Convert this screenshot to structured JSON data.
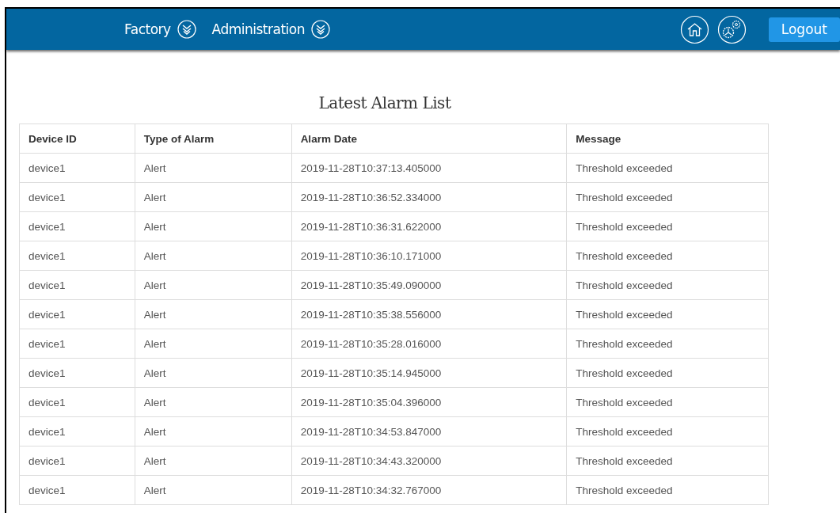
{
  "nav": {
    "menus": [
      {
        "label": "Factory"
      },
      {
        "label": "Administration"
      }
    ],
    "logout": "Logout"
  },
  "title": "Latest Alarm List",
  "table": {
    "columns": [
      "Device ID",
      "Type of Alarm",
      "Alarm Date",
      "Message"
    ],
    "rows": [
      [
        "device1",
        "Alert",
        "2019-11-28T10:37:13.405000",
        "Threshold exceeded"
      ],
      [
        "device1",
        "Alert",
        "2019-11-28T10:36:52.334000",
        "Threshold exceeded"
      ],
      [
        "device1",
        "Alert",
        "2019-11-28T10:36:31.622000",
        "Threshold exceeded"
      ],
      [
        "device1",
        "Alert",
        "2019-11-28T10:36:10.171000",
        "Threshold exceeded"
      ],
      [
        "device1",
        "Alert",
        "2019-11-28T10:35:49.090000",
        "Threshold exceeded"
      ],
      [
        "device1",
        "Alert",
        "2019-11-28T10:35:38.556000",
        "Threshold exceeded"
      ],
      [
        "device1",
        "Alert",
        "2019-11-28T10:35:28.016000",
        "Threshold exceeded"
      ],
      [
        "device1",
        "Alert",
        "2019-11-28T10:35:14.945000",
        "Threshold exceeded"
      ],
      [
        "device1",
        "Alert",
        "2019-11-28T10:35:04.396000",
        "Threshold exceeded"
      ],
      [
        "device1",
        "Alert",
        "2019-11-28T10:34:53.847000",
        "Threshold exceeded"
      ],
      [
        "device1",
        "Alert",
        "2019-11-28T10:34:43.320000",
        "Threshold exceeded"
      ],
      [
        "device1",
        "Alert",
        "2019-11-28T10:34:32.767000",
        "Threshold exceeded"
      ]
    ]
  }
}
